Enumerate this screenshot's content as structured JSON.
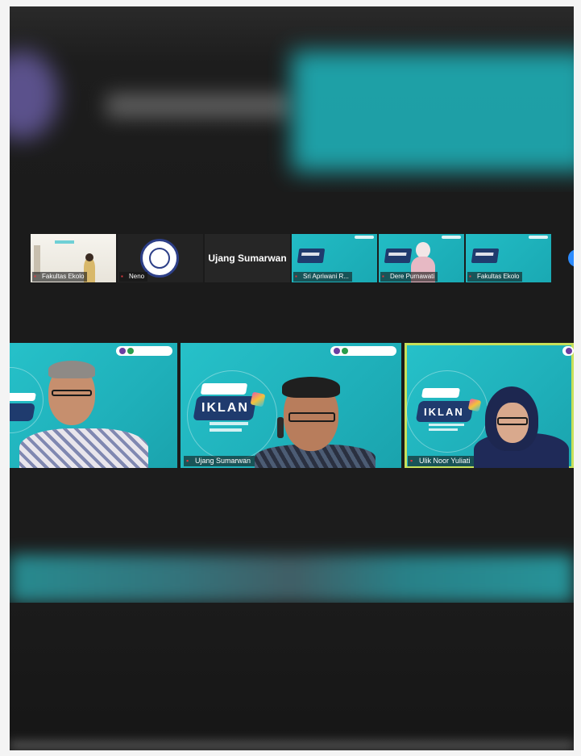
{
  "thumbnails": [
    {
      "label": "Fakultas Ekolo"
    },
    {
      "label": "Neno"
    },
    {
      "name": "Ujang Sumarwan"
    },
    {
      "label": "Sri Apriwani R..."
    },
    {
      "label": "Dere Purnawati"
    },
    {
      "label": "Fakultas Ekolo"
    }
  ],
  "next_icon": "chevron-right-icon",
  "tiles": [
    {
      "label": ""
    },
    {
      "label": "Ujang Sumarwan"
    },
    {
      "label": "Ulik Noor Yuliati"
    }
  ],
  "slide": {
    "title": "IKLAN"
  },
  "colors": {
    "teal": "#22bcc5",
    "navy": "#1f3b6e",
    "active_border": "#c7e05a",
    "accent_blue": "#2d8cff",
    "muted_mic": "#e0383e"
  }
}
